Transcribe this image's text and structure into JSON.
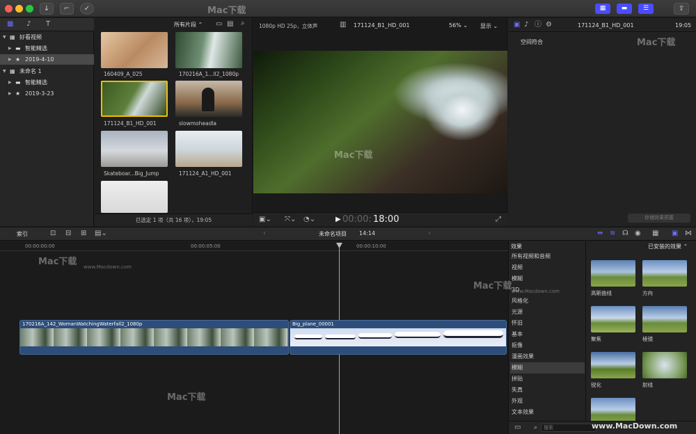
{
  "titlebar": {
    "btn_import": "↓",
    "btn_keys": "⌐",
    "btn_check": "✓",
    "btn_share": "⇪"
  },
  "library": {
    "items": [
      {
        "label": "好看视频",
        "level": 0,
        "arrow": "▼",
        "icon": "event-grid-icon"
      },
      {
        "label": "智能精选",
        "level": 1,
        "arrow": "▶",
        "icon": "folder-icon"
      },
      {
        "label": "2019-4-10",
        "level": 1,
        "arrow": "▶",
        "icon": "star-event-icon",
        "selected": true
      },
      {
        "label": "未命名 1",
        "level": 0,
        "arrow": "▼",
        "icon": "event-grid-icon"
      },
      {
        "label": "智能精选",
        "level": 1,
        "arrow": "▶",
        "icon": "folder-icon"
      },
      {
        "label": "2019-3-23",
        "level": 1,
        "arrow": "▶",
        "icon": "star-event-icon"
      }
    ]
  },
  "browser": {
    "filter": "所有片段 ⌃",
    "clips": [
      {
        "label": "160409_A_025"
      },
      {
        "label": "170216A_1...ll2_1080p"
      },
      {
        "label": "171124_B1_HD_001"
      },
      {
        "label": "slowmoheadla"
      },
      {
        "label": "Skateboar...Big_Jump"
      },
      {
        "label": "171124_A1_HD_001"
      },
      {
        "label": ""
      }
    ],
    "status": "已选定 1 项（共 16 项），19:05"
  },
  "viewer": {
    "format": "1080p HD 25p，立体声",
    "clip_name": "171124_B1_HD_001",
    "zoom": "56% ⌄",
    "display": "显示 ⌄",
    "timecode_dim": "00:00:",
    "timecode": "18:00"
  },
  "inspector": {
    "clip_name": "171124_B1_HD_001",
    "duration": "19:05",
    "section": "空间符合",
    "save_btn": "存储效果预置"
  },
  "timeline_bar": {
    "index": "索引",
    "project": "未命名项目",
    "project_duration": "14:14"
  },
  "timeline": {
    "ruler": [
      "00:00:00:00",
      "00:00:05:00",
      "00:00:10:00"
    ],
    "clips": [
      {
        "label": "170216A_142_WomanWatchingWaterfall2_1080p"
      },
      {
        "label": "Big_plane_00001"
      }
    ]
  },
  "effects": {
    "header": "效果",
    "installed": "已安装的效果 ⌃",
    "categories": [
      "所有视频和音频",
      "视频",
      "模糊",
      "3D",
      "风格化",
      "光源",
      "怀旧",
      "基本",
      "抠像",
      "漫画效果",
      "模糊",
      "拼贴",
      "失真",
      "外观",
      "文本效果"
    ],
    "selected_index": 10,
    "items": [
      "高斯曲线",
      "方向",
      "聚焦",
      "棱镜",
      "锐化",
      "射线",
      "",
      ""
    ],
    "search_placeholder": "搜索"
  },
  "watermarks": {
    "brand": "Mac下载",
    "url": "www.Macdown.com",
    "footer": "www.MacDown.com"
  },
  "colors": {
    "accent": "#5a5cff",
    "selection": "#f0c000",
    "clip_blue": "#2d4d7a"
  }
}
